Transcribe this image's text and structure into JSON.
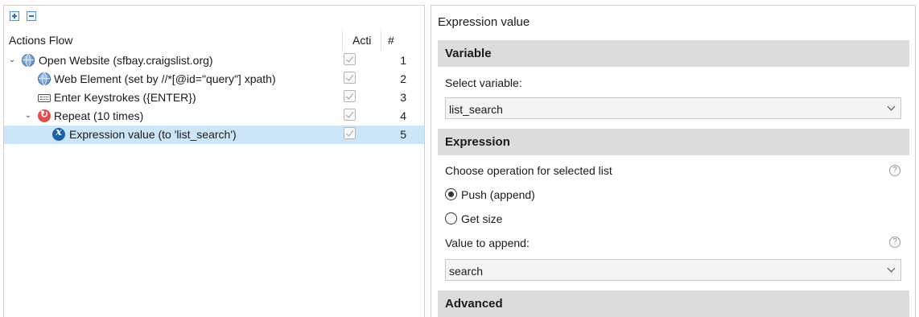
{
  "tree": {
    "columns": {
      "flow": "Actions Flow",
      "active": "Acti",
      "number": "#"
    },
    "rows": [
      {
        "label": "Open Website (sfbay.craigslist.org)",
        "icon": "globe-icon",
        "active": true,
        "number": "1",
        "expanded": true
      },
      {
        "label": "Web Element (set by //*[@id=\"query\"] xpath)",
        "icon": "globe-icon",
        "active": true,
        "number": "2"
      },
      {
        "label": "Enter Keystrokes ({ENTER})",
        "icon": "keyboard-icon",
        "active": true,
        "number": "3"
      },
      {
        "label": "Repeat (10 times)",
        "icon": "repeat-icon",
        "active": true,
        "number": "4",
        "expanded": true
      },
      {
        "label": "Expression value (to 'list_search')",
        "icon": "expression-icon",
        "active": true,
        "number": "5",
        "selected": true
      }
    ]
  },
  "editor": {
    "title": "Expression value",
    "variable_section": "Variable",
    "select_variable_label": "Select variable:",
    "select_variable_value": "list_search",
    "expression_section": "Expression",
    "operation_label": "Choose operation for selected list",
    "options": [
      {
        "label": "Push (append)",
        "checked": true
      },
      {
        "label": "Get size",
        "checked": false
      }
    ],
    "value_label": "Value to append:",
    "value_value": "search",
    "advanced_section": "Advanced",
    "help_glyph": "?"
  },
  "colors": {
    "selected_row": "#cde6f7",
    "section_bg": "#dcdcdc"
  }
}
